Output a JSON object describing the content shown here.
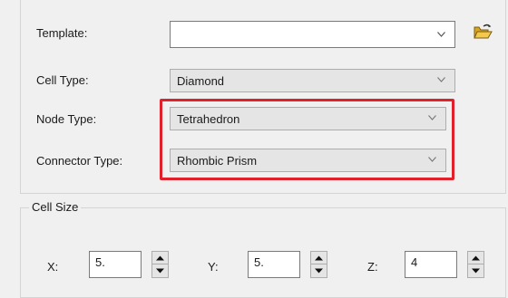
{
  "template": {
    "label": "Template:",
    "value": "",
    "icon": "folder-open-icon"
  },
  "cell_type": {
    "label": "Cell Type:",
    "value": "Diamond"
  },
  "node_type": {
    "label": "Node Type:",
    "value": "Tetrahedron"
  },
  "connector_type": {
    "label": "Connector Type:",
    "value": "Rhombic Prism"
  },
  "highlight_color": "#e0202a",
  "cell_size": {
    "title": "Cell Size",
    "x": {
      "label": "X:",
      "value": "5."
    },
    "y": {
      "label": "Y:",
      "value": "5."
    },
    "z": {
      "label": "Z:",
      "value": "4"
    }
  }
}
